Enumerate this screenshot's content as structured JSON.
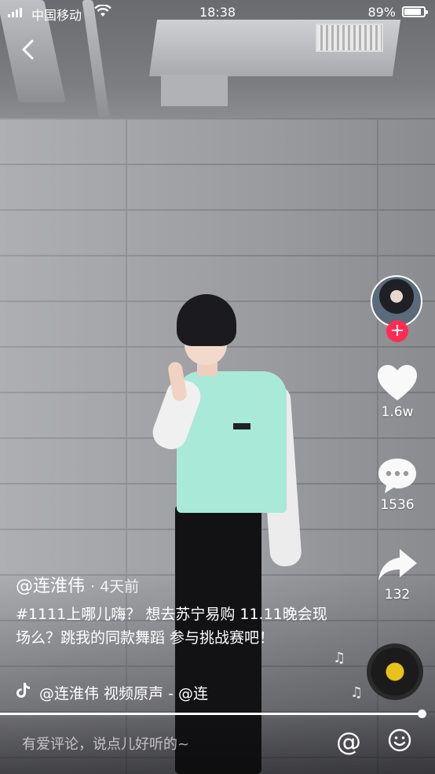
{
  "status_bar": {
    "carrier": "中国移动",
    "time": "18:38",
    "battery_percent": "89%",
    "battery_level": 0.89
  },
  "rail": {
    "likes": "1.6w",
    "comments": "1536",
    "shares": "132",
    "follow_symbol": "+"
  },
  "caption": {
    "author": "@连淮伟",
    "time_ago": "· 4天前",
    "text": "#1111上哪儿嗨？ 想去苏宁易购 11.11晚会现场么？跳我的同款舞蹈 参与挑战赛吧！",
    "music": "@连淮伟    视频原声 - @连"
  },
  "comment_bar": {
    "placeholder": "有爱评论，说点儿好听的~",
    "at_symbol": "@"
  },
  "colors": {
    "accent": "#fe2c55",
    "disc_center": "#e7c21c"
  },
  "icons": [
    "back-chevron-icon",
    "heart-icon",
    "comment-icon",
    "share-icon",
    "tiktok-note-icon",
    "music-disc-icon",
    "emoji-icon",
    "at-icon"
  ]
}
